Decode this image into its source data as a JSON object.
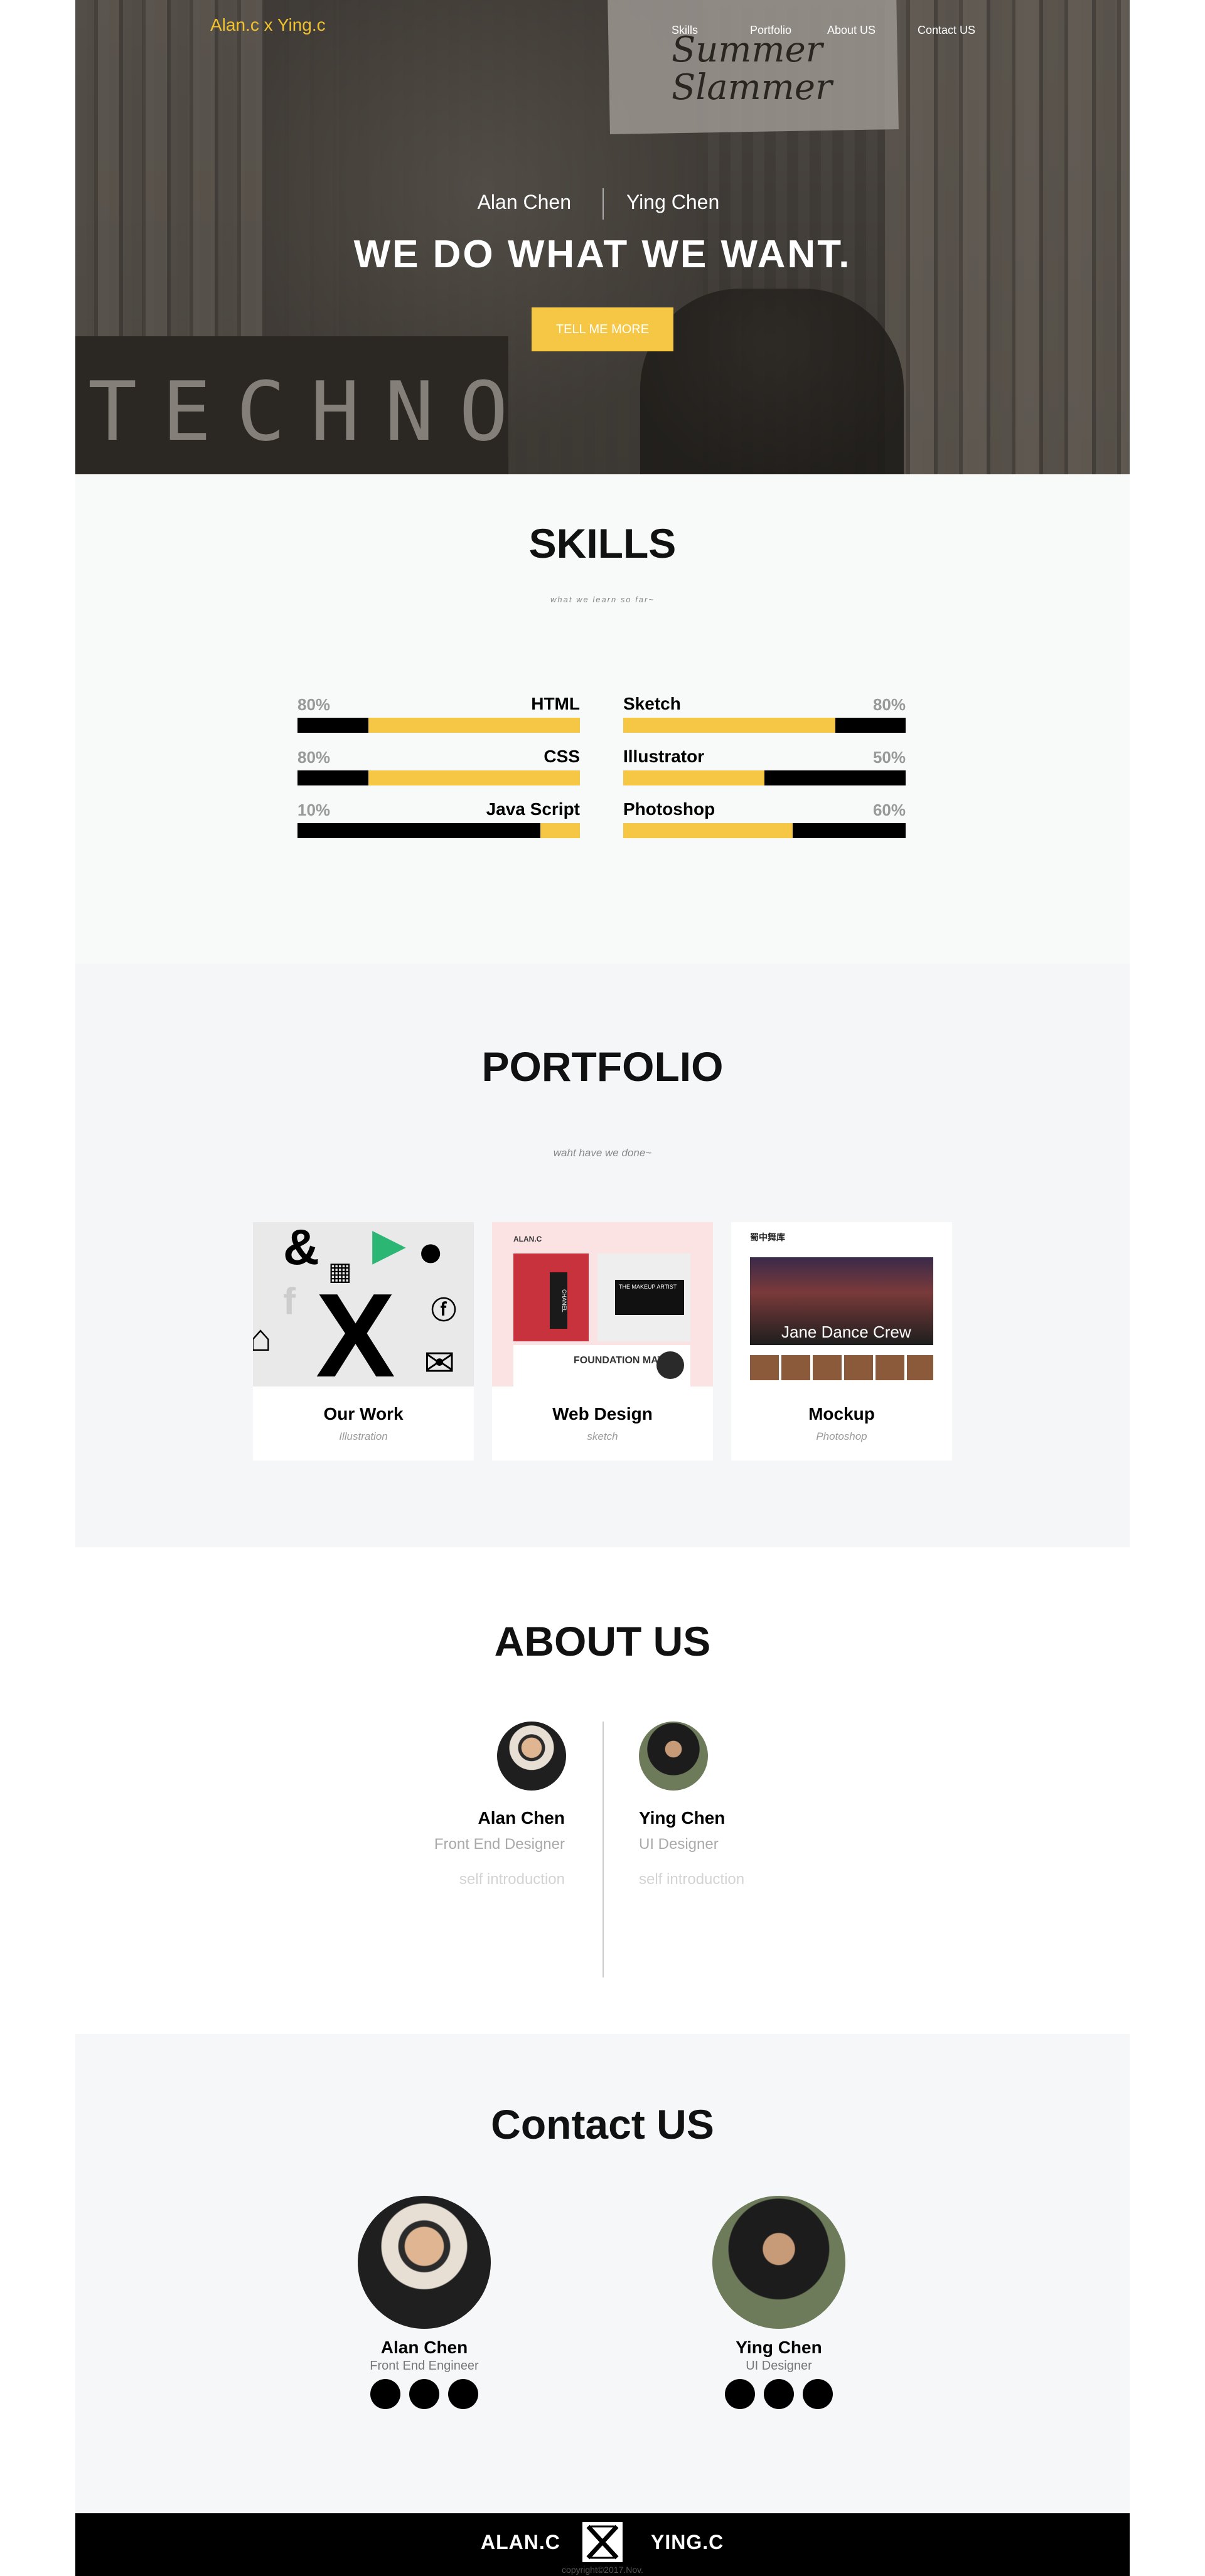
{
  "brand": "Alan.c x Ying.c",
  "nav": [
    "Skills",
    "Portfolio",
    "About US",
    "Contact US"
  ],
  "hero": {
    "name_left": "Alan Chen",
    "name_right": "Ying Chen",
    "headline": "WE DO WHAT WE WANT.",
    "cta": "TELL ME MORE",
    "bg_sign": "Summer Slammer",
    "bg_word": "TECHNO"
  },
  "skills": {
    "title": "SKILLS",
    "subtitle": "what we learn so far~",
    "left": [
      {
        "name": "HTML",
        "pct_label": "80%",
        "dark": 0.25
      },
      {
        "name": "CSS",
        "pct_label": "80%",
        "dark": 0.25
      },
      {
        "name": "Java Script",
        "pct_label": "10%",
        "dark": 0.86
      }
    ],
    "right": [
      {
        "name": "Sketch",
        "pct_label": "80%",
        "dark": 0.25
      },
      {
        "name": "Illustrator",
        "pct_label": "50%",
        "dark": 0.5
      },
      {
        "name": "Photoshop",
        "pct_label": "60%",
        "dark": 0.4
      }
    ]
  },
  "portfolio": {
    "title": "PORTFOLIO",
    "subtitle": "waht have we done~",
    "cards": [
      {
        "title": "Our Work",
        "sub": "Illustration"
      },
      {
        "title": "Web Design",
        "sub": "sketch"
      },
      {
        "title": "Mockup",
        "sub": "Photoshop"
      }
    ],
    "web_thumb": {
      "logo": "ALAN.C",
      "brand": "CHANEL",
      "promo": "THE MAKEUP ARTIST",
      "match": "FOUNDATION MATCH"
    },
    "mock_thumb": {
      "logo": "蜀中舞库",
      "caption": "Jane Dance Crew"
    }
  },
  "about": {
    "title": "ABOUT US",
    "people": [
      {
        "name": "Alan Chen",
        "role": "Front End Designer",
        "intro": "self introduction"
      },
      {
        "name": "Ying Chen",
        "role": "UI Designer",
        "intro": "self introduction"
      }
    ]
  },
  "contact": {
    "title": "Contact US",
    "people": [
      {
        "name": "Alan Chen",
        "role": "Front End Engineer"
      },
      {
        "name": "Ying Chen",
        "role": "UI Designer"
      }
    ]
  },
  "footer": {
    "left": "ALAN.C",
    "right": "YING.C",
    "copyright": "copyright©2017.Nov."
  },
  "colors": {
    "accent": "#f6c744",
    "brand": "#f2c12e",
    "dark": "#000000"
  }
}
